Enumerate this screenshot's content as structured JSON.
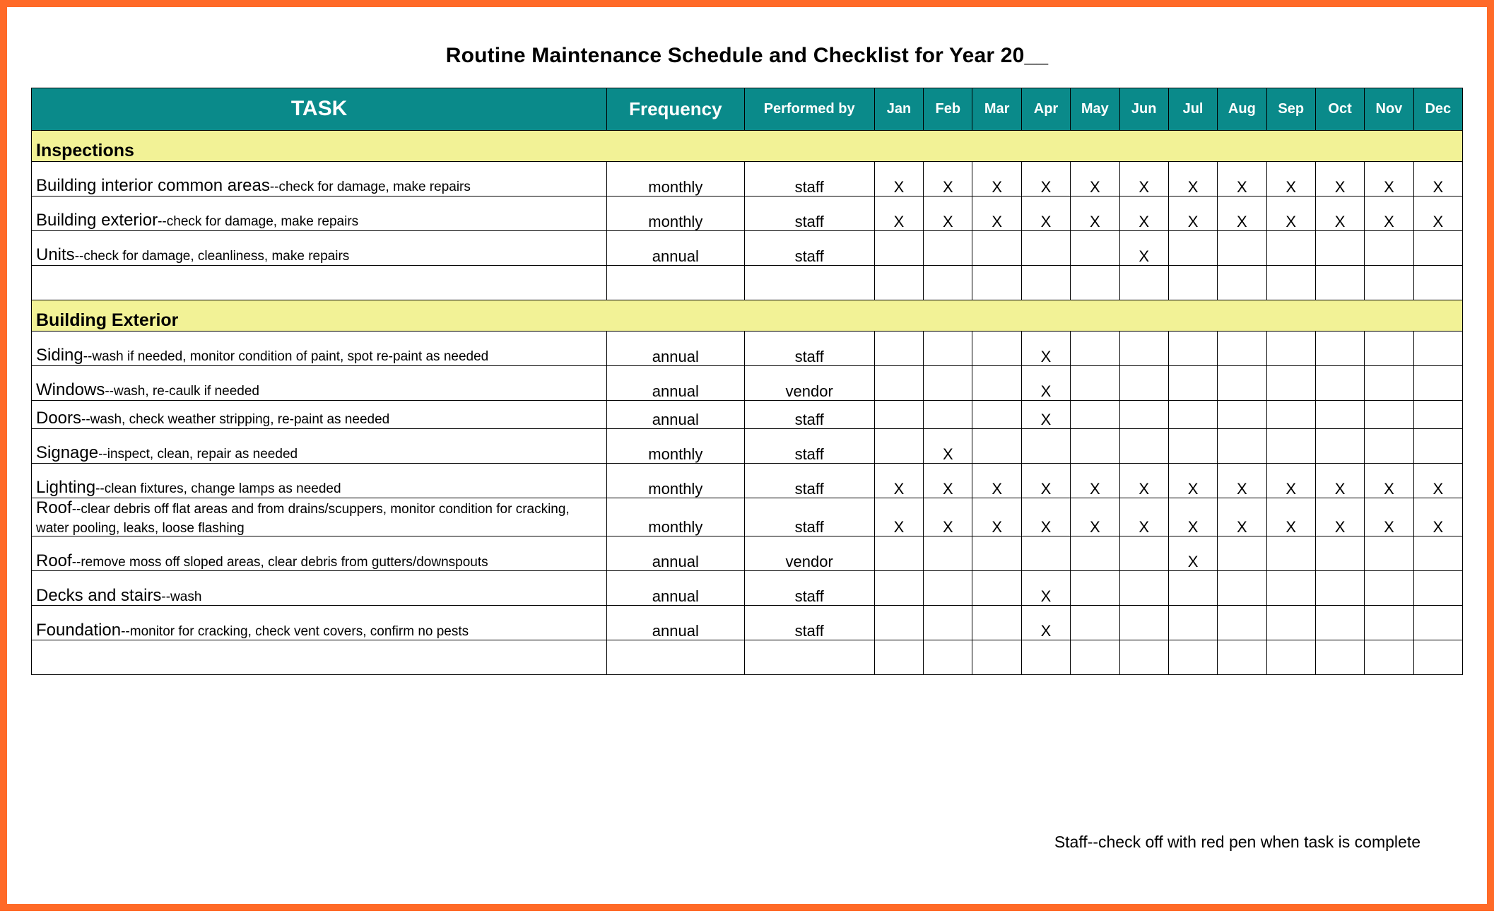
{
  "title": "Routine Maintenance Schedule and Checklist for Year 20__",
  "headers": {
    "task": "TASK",
    "frequency": "Frequency",
    "performed_by": "Performed by",
    "months": [
      "Jan",
      "Feb",
      "Mar",
      "Apr",
      "May",
      "Jun",
      "Jul",
      "Aug",
      "Sep",
      "Oct",
      "Nov",
      "Dec"
    ]
  },
  "mark": "X",
  "sections": [
    {
      "name": "Inspections",
      "rows": [
        {
          "task_name": "Building interior common areas",
          "task_desc": "--check for damage, make repairs",
          "frequency": "monthly",
          "performed_by": "staff",
          "months": [
            "X",
            "X",
            "X",
            "X",
            "X",
            "X",
            "X",
            "X",
            "X",
            "X",
            "X",
            "X"
          ]
        },
        {
          "task_name": "Building exterior",
          "task_desc": "--check for damage, make repairs",
          "frequency": "monthly",
          "performed_by": "staff",
          "months": [
            "X",
            "X",
            "X",
            "X",
            "X",
            "X",
            "X",
            "X",
            "X",
            "X",
            "X",
            "X"
          ]
        },
        {
          "task_name": "Units",
          "task_desc": "--check for damage, cleanliness, make repairs",
          "frequency": "annual",
          "performed_by": "staff",
          "months": [
            "",
            "",
            "",
            "",
            "",
            "X",
            "",
            "",
            "",
            "",
            "",
            ""
          ]
        }
      ],
      "trailing_blank_rows": 1
    },
    {
      "name": "Building Exterior",
      "rows": [
        {
          "task_name": "Siding",
          "task_desc": "--wash if needed, monitor condition of paint, spot re-paint as needed",
          "frequency": "annual",
          "performed_by": "staff",
          "months": [
            "",
            "",
            "",
            "X",
            "",
            "",
            "",
            "",
            "",
            "",
            "",
            ""
          ]
        },
        {
          "task_name": "Windows",
          "task_desc": "--wash, re-caulk if needed",
          "frequency": "annual",
          "performed_by": "vendor",
          "months": [
            "",
            "",
            "",
            "X",
            "",
            "",
            "",
            "",
            "",
            "",
            "",
            ""
          ]
        },
        {
          "task_name": "Doors",
          "task_desc": "--wash, check weather stripping, re-paint as needed",
          "frequency": "annual",
          "performed_by": "staff",
          "months": [
            "",
            "",
            "",
            "X",
            "",
            "",
            "",
            "",
            "",
            "",
            "",
            ""
          ],
          "short": true
        },
        {
          "task_name": "Signage",
          "task_desc": "--inspect, clean, repair as needed",
          "frequency": "monthly",
          "performed_by": "staff",
          "months": [
            "",
            "X",
            "",
            "",
            "",
            "",
            "",
            "",
            "",
            "",
            "",
            ""
          ]
        },
        {
          "task_name": "Lighting",
          "task_desc": "--clean fixtures, change lamps as needed",
          "frequency": "monthly",
          "performed_by": "staff",
          "months": [
            "X",
            "X",
            "X",
            "X",
            "X",
            "X",
            "X",
            "X",
            "X",
            "X",
            "X",
            "X"
          ]
        },
        {
          "task_name": "Roof",
          "task_desc": "--clear debris off flat areas and from drains/scuppers, monitor condition for cracking, water pooling, leaks, loose flashing",
          "frequency": "monthly",
          "performed_by": "staff",
          "months": [
            "X",
            "X",
            "X",
            "X",
            "X",
            "X",
            "X",
            "X",
            "X",
            "X",
            "X",
            "X"
          ],
          "tall": true
        },
        {
          "task_name": "Roof",
          "task_desc": "--remove moss off sloped areas, clear debris from gutters/downspouts",
          "frequency": "annual",
          "performed_by": "vendor",
          "months": [
            "",
            "",
            "",
            "",
            "",
            "",
            "X",
            "",
            "",
            "",
            "",
            ""
          ]
        },
        {
          "task_name": "Decks and stairs",
          "task_desc": "--wash",
          "frequency": "annual",
          "performed_by": "staff",
          "months": [
            "",
            "",
            "",
            "X",
            "",
            "",
            "",
            "",
            "",
            "",
            "",
            ""
          ]
        },
        {
          "task_name": "Foundation",
          "task_desc": "--monitor for cracking, check vent covers, confirm no pests",
          "frequency": "annual",
          "performed_by": "staff",
          "months": [
            "",
            "",
            "",
            "X",
            "",
            "",
            "",
            "",
            "",
            "",
            "",
            ""
          ]
        }
      ],
      "trailing_blank_rows": 1
    }
  ],
  "footer_note": "Staff--check off with red pen when task is complete"
}
